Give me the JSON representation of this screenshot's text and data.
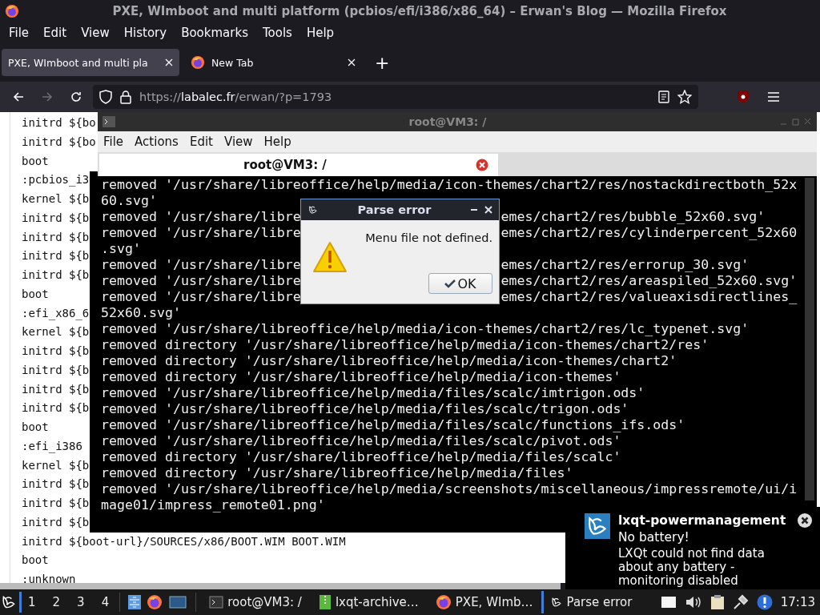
{
  "browser": {
    "title": "PXE, WImboot and multi platform (pcbios/efi/i386/x86_64) – Erwan's Blog — Mozilla Firefox",
    "menu": [
      "File",
      "Edit",
      "View",
      "History",
      "Bookmarks",
      "Tools",
      "Help"
    ],
    "tabs": [
      {
        "label": "PXE, WImboot and multi pla",
        "selected": true
      },
      {
        "label": "New Tab",
        "selected": false
      }
    ],
    "new_tab": "+",
    "forward": {
      "disabled": true
    },
    "url": {
      "scheme": "https://",
      "host": "labalec.fr",
      "path": "/erwan/?p=1793"
    },
    "page_lines": [
      "initrd ${bo",
      "initrd ${bo",
      "boot",
      ":pcbios_i3",
      "kernel ${b",
      "initrd ${b",
      "initrd ${b",
      "initrd ${b",
      "initrd ${b",
      "boot",
      ":efi_x86_6",
      "kernel ${b",
      "initrd ${b",
      "initrd ${b",
      "initrd ${b",
      "initrd ${b",
      "boot",
      ":efi_i386",
      "kernel ${b",
      "initrd ${b",
      "initrd ${b",
      "initrd ${b",
      "initrd ${boot-url}/SOURCES/x86/BOOT.WIM BOOT.WIM",
      "boot",
      ":unknown"
    ]
  },
  "terminal": {
    "title": "root@VM3: /",
    "menu": [
      "File",
      "Actions",
      "Edit",
      "View",
      "Help"
    ],
    "tabs": [
      {
        "label": "root@VM3: /",
        "selected": true
      }
    ],
    "lines": [
      {
        "left": "removed '/usr/share/libreoffice/help/media/icon-themes/chart2/res/nostackdirectboth_52x"
      },
      {
        "left": "60.svg'"
      },
      {
        "left": "removed '/usr/share/libre",
        "right": "emes/chart2/res/bubble_52x60.svg'"
      },
      {
        "left": "removed '/usr/share/libre",
        "right": "emes/chart2/res/cylinderpercent_52x60"
      },
      {
        "left": ".svg'"
      },
      {
        "left": "removed '/usr/share/libre",
        "right": "emes/chart2/res/errorup_30.svg'"
      },
      {
        "left": "removed '/usr/share/libre",
        "right": "emes/chart2/res/areaspiled_52x60.svg'"
      },
      {
        "left": "removed '/usr/share/libre",
        "right": "emes/chart2/res/valueaxisdirectlines_"
      },
      {
        "left": "52x60.svg'"
      },
      {
        "left": "removed '/usr/share/libreoffice/help/media/icon-themes/chart2/res/lc_typenet.svg'"
      },
      {
        "left": "removed directory '/usr/share/libreoffice/help/media/icon-themes/chart2/res'"
      },
      {
        "left": "removed directory '/usr/share/libreoffice/help/media/icon-themes/chart2'"
      },
      {
        "left": "removed directory '/usr/share/libreoffice/help/media/icon-themes'"
      },
      {
        "left": "removed '/usr/share/libreoffice/help/media/files/scalc/imtrigon.ods'"
      },
      {
        "left": "removed '/usr/share/libreoffice/help/media/files/scalc/trigon.ods'"
      },
      {
        "left": "removed '/usr/share/libreoffice/help/media/files/scalc/functions_ifs.ods'"
      },
      {
        "left": "removed '/usr/share/libreoffice/help/media/files/scalc/pivot.ods'"
      },
      {
        "left": "removed directory '/usr/share/libreoffice/help/media/files/scalc'"
      },
      {
        "left": "removed directory '/usr/share/libreoffice/help/media/files'"
      },
      {
        "left": "removed '/usr/share/libreoffice/help/media/screenshots/miscellaneous/impressremote/ui/i"
      },
      {
        "left": "mage01/impress_remote01.png'"
      }
    ]
  },
  "dialog": {
    "title": "Parse error",
    "message": "Menu file not defined.",
    "button": "OK"
  },
  "notification": {
    "title": "lxqt-powermanagement",
    "summary": "No battery!",
    "body": "LXQt could not find data about any battery - monitoring disabled"
  },
  "taskbar": {
    "desktops": [
      {
        "label": "1",
        "selected": true
      },
      {
        "label": "2",
        "selected": false
      },
      {
        "label": "3",
        "selected": false
      },
      {
        "label": "4",
        "selected": false
      }
    ],
    "tasks": [
      {
        "label": "root@VM3: /",
        "kind": "terminal",
        "selected": false
      },
      {
        "label": "lxqt-archive…",
        "kind": "archive",
        "selected": false
      },
      {
        "label": "PXE, WImb…",
        "kind": "firefox",
        "selected": false
      },
      {
        "label": "Parse error",
        "kind": "lxqt",
        "selected": true
      }
    ],
    "clock": "17:13"
  }
}
